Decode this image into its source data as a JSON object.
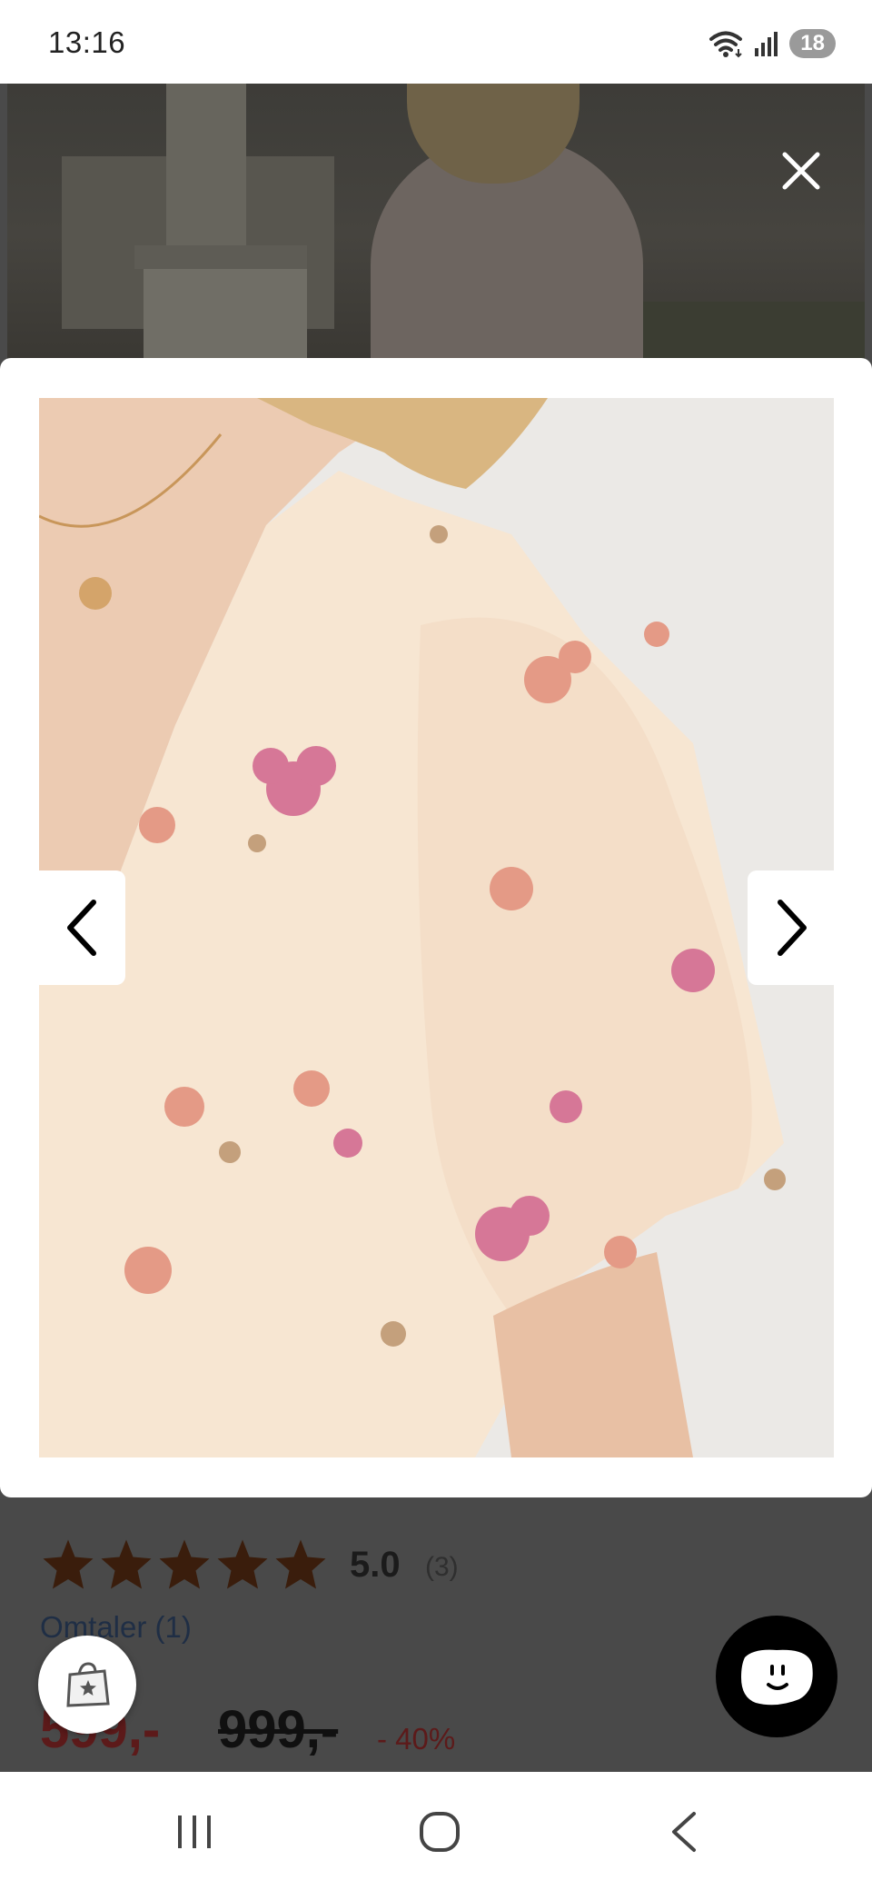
{
  "status_bar": {
    "time": "13:16",
    "battery_level": "18",
    "icons": [
      "wifi-icon",
      "signal-icon",
      "battery-icon"
    ]
  },
  "overlay": {
    "close_icon": "close-icon",
    "prev_icon": "chevron-left-icon",
    "next_icon": "chevron-right-icon"
  },
  "product": {
    "rating": {
      "stars_filled": 5,
      "stars_total": 5,
      "value": "5.0",
      "count": "(3)"
    },
    "reviews_link": "Omtaler (1)",
    "price": {
      "sale": "599,-",
      "original": "999,-",
      "discount": "- 40%"
    }
  },
  "fabs": {
    "left_icon": "shopping-bag-star-icon",
    "right_icon": "chat-smiley-icon"
  },
  "system_nav": {
    "recents_icon": "recents-icon",
    "home_icon": "home-icon",
    "back_icon": "back-icon"
  },
  "colors": {
    "star": "#3a1d0c",
    "sale_price": "#5c1a1a",
    "link": "#1f2e45",
    "overlay": "#494949"
  }
}
